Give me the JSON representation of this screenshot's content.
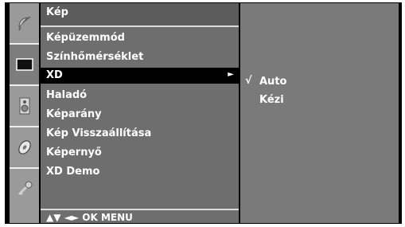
{
  "menu": {
    "title": "Kép",
    "items": [
      {
        "label": "Képüzemmód"
      },
      {
        "label": "Színhőmérséklet"
      },
      {
        "label": "XD",
        "arrow": "►"
      },
      {
        "label": "Haladó"
      },
      {
        "label": "Képarány"
      },
      {
        "label": "Kép Visszaállítása"
      },
      {
        "label": "Képernyő"
      },
      {
        "label": "XD Demo"
      }
    ],
    "selected_index": 2,
    "nav_hint": "▲▼ ◄► OK  MENU"
  },
  "submenu": {
    "check_mark": "√",
    "options": [
      {
        "label": "Auto",
        "checked": true
      },
      {
        "label": "Kézi",
        "checked": false
      }
    ]
  },
  "sidebar": {
    "icons": [
      "satellite-dish-icon",
      "picture-icon",
      "speaker-icon",
      "disc-icon",
      "key-icon"
    ],
    "active": "picture-icon"
  }
}
